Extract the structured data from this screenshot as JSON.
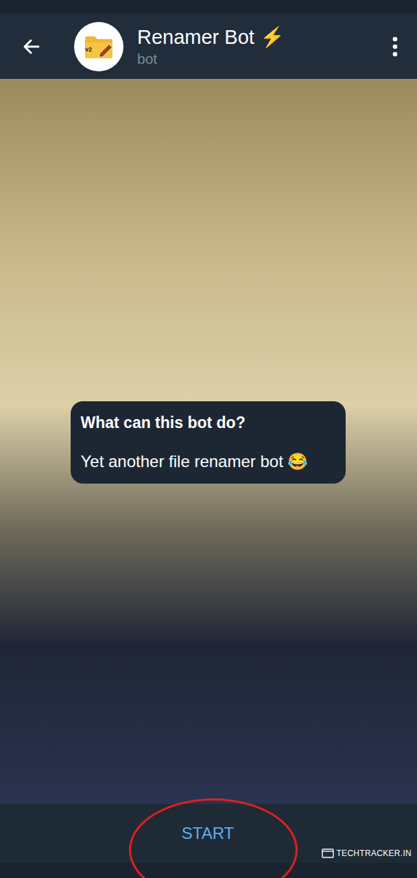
{
  "header": {
    "title": "Renamer Bot ⚡",
    "subtitle": "bot",
    "avatar_badge": "v2"
  },
  "intro": {
    "title": "What can this bot do?",
    "text": "Yet another file renamer bot 😂"
  },
  "start_button": {
    "label": "START"
  },
  "watermark": {
    "text": "TECHTRACKER.IN"
  }
}
